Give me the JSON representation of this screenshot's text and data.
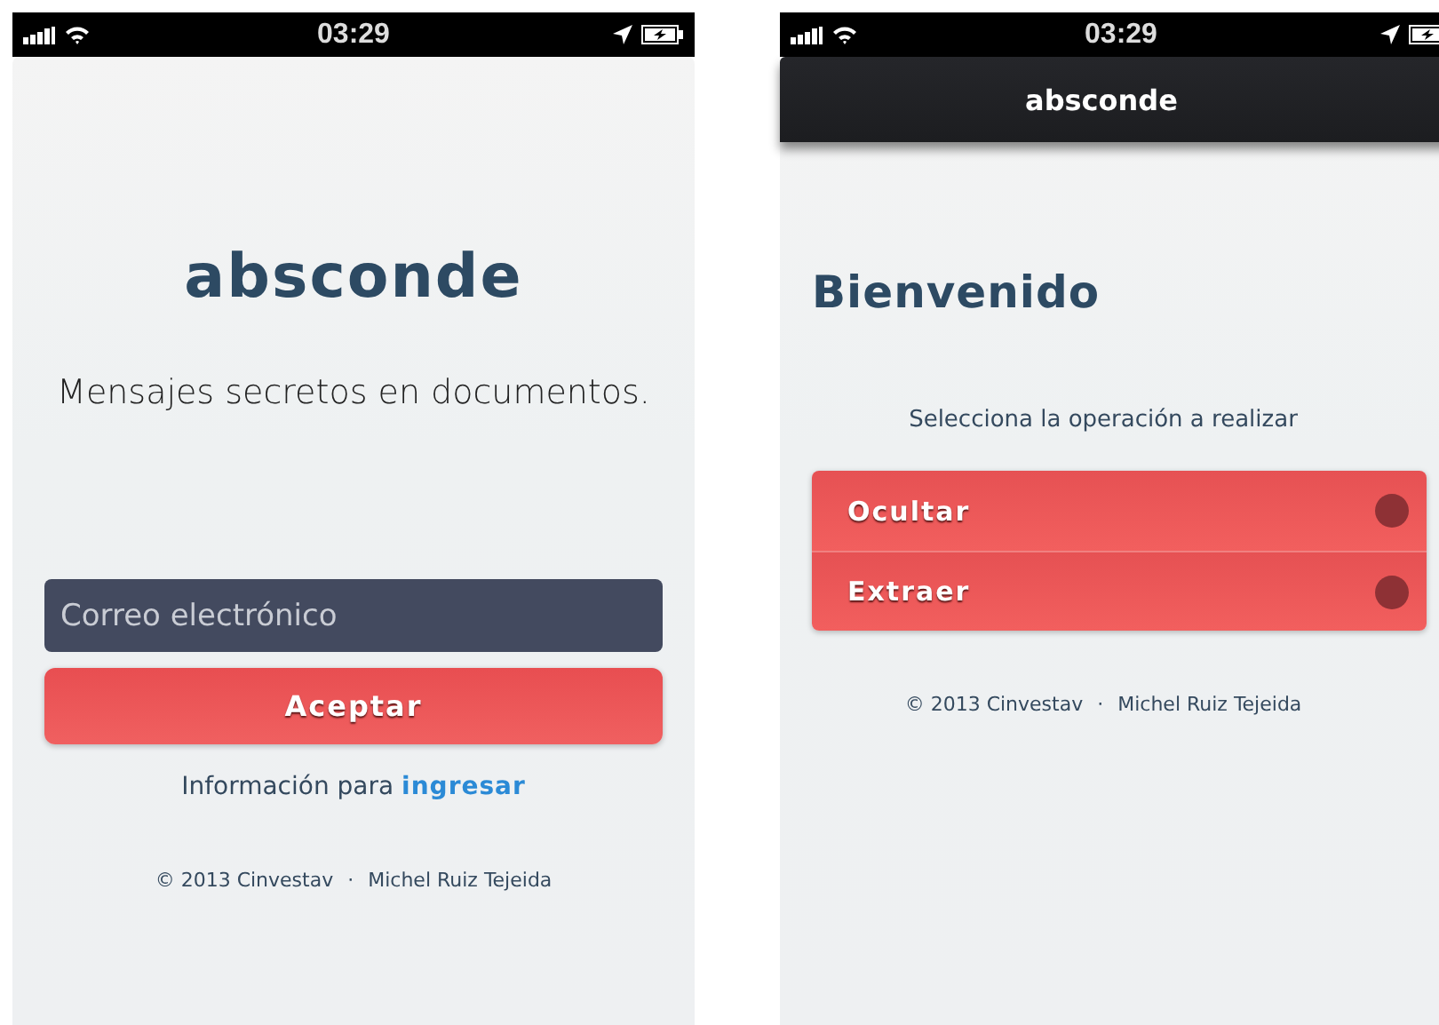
{
  "screens": [
    {
      "kind": "login",
      "status_bar": {
        "time": "03:29"
      },
      "logo": "absconde",
      "tagline": "Mensajes secretos en documentos.",
      "email_field": {
        "placeholder": "Correo electrónico"
      },
      "submit_button": "Aceptar",
      "info": {
        "text": "Información para",
        "link": "ingresar"
      },
      "footer": [
        "© 2013 Cinvestav",
        "·",
        "Michel Ruiz Tejeida"
      ]
    },
    {
      "kind": "menu",
      "status_bar": {
        "time": "03:29"
      },
      "nav_title": "absconde",
      "heading": "Bienvenido",
      "prompt": "Selecciona la operación a realizar",
      "options": [
        {
          "label": "Ocultar",
          "selected": false
        },
        {
          "label": "Extraer",
          "selected": false
        }
      ],
      "footer": [
        "© 2013 Cinvestav",
        "·",
        "Michel Ruiz Tejeida"
      ]
    }
  ]
}
